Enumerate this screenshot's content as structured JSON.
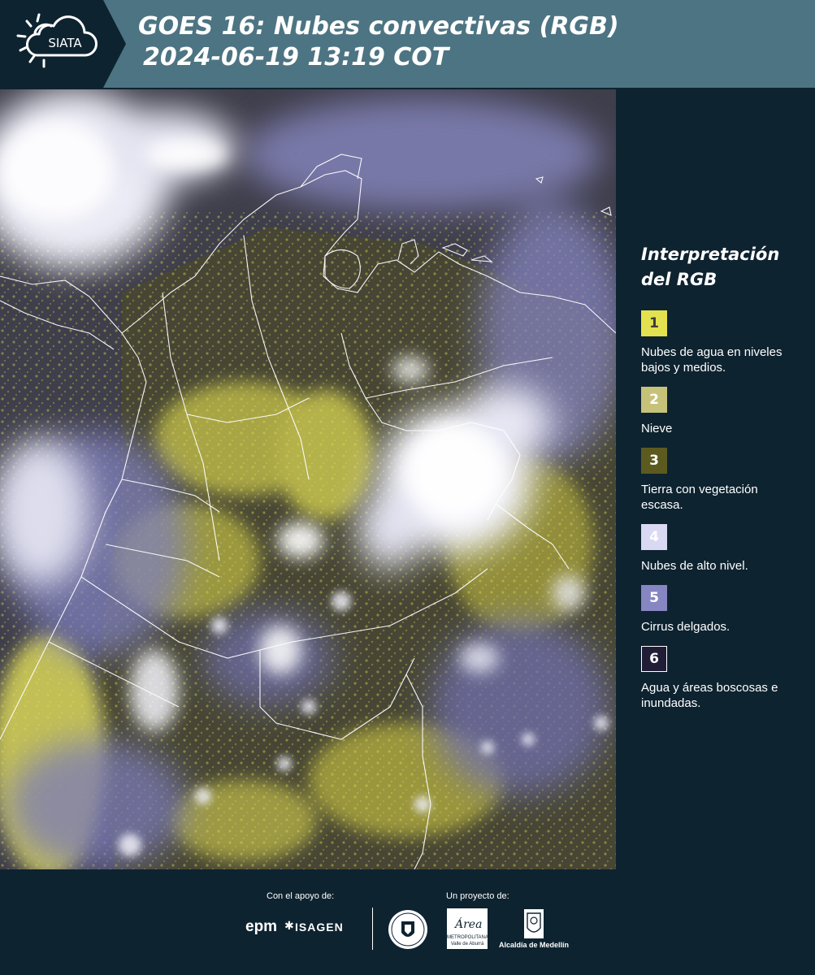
{
  "header": {
    "logo_text": "SIATA",
    "title_line1": "GOES 16: Nubes convectivas (RGB)",
    "title_line2": "2024-06-19 13:19 COT",
    "background_color": "#4d7482"
  },
  "legend": {
    "title_line1": "Interpretación",
    "title_line2": "del RGB",
    "items": [
      {
        "number": "1",
        "label": "Nubes de agua en niveles bajos y medios.",
        "color": "#e3e14f"
      },
      {
        "number": "2",
        "label": "Nieve",
        "color": "#c6c27a"
      },
      {
        "number": "3",
        "label": "Tierra con vegetación escasa.",
        "color": "#5d5a20"
      },
      {
        "number": "4",
        "label": "Nubes de alto nivel.",
        "color": "#d9d9f3"
      },
      {
        "number": "5",
        "label": "Cirrus delgados.",
        "color": "#8686c2"
      },
      {
        "number": "6",
        "label": "Agua y áreas boscosas e inundadas.",
        "color": "#221d36"
      }
    ]
  },
  "footer": {
    "support_label": "Con el apoyo de:",
    "project_label": "Un proyecto de:",
    "sponsors": [
      "epm",
      "ISAGEN"
    ],
    "partners": {
      "area_metro_name": "Área",
      "area_metro_caption1": "METROPOLITANA",
      "area_metro_caption2": "Valle de Aburrá",
      "alcaldia": "Alcaldía de Medellín"
    }
  },
  "map": {
    "icons": [
      "satellite-image"
    ]
  }
}
